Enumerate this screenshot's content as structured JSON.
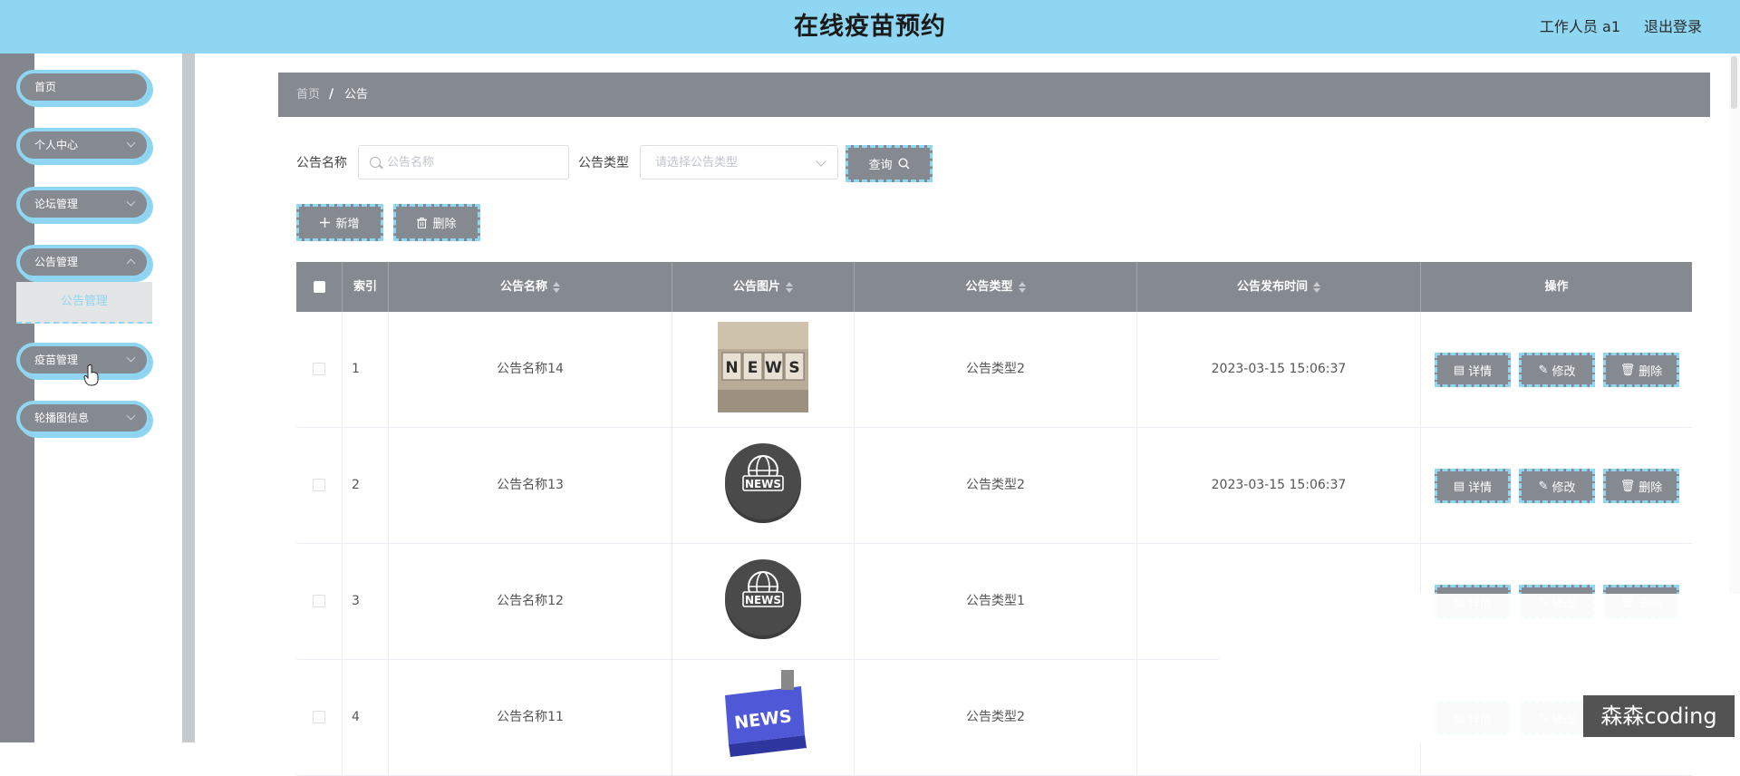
{
  "header": {
    "title": "在线疫苗预约",
    "user": "工作人员 a1",
    "logout": "退出登录"
  },
  "sidebar": {
    "items": [
      {
        "label": "首页",
        "chevron": false
      },
      {
        "label": "个人中心",
        "chevron": true
      },
      {
        "label": "论坛管理",
        "chevron": true
      },
      {
        "label": "公告管理",
        "chevron": true
      },
      {
        "label": "疫苗管理",
        "chevron": true
      },
      {
        "label": "轮播图信息",
        "chevron": true
      }
    ],
    "submenu": {
      "label": "公告管理"
    }
  },
  "breadcrumb": {
    "home": "首页",
    "separator": "/",
    "current": "公告"
  },
  "search": {
    "name_label": "公告名称",
    "name_placeholder": "公告名称",
    "type_label": "公告类型",
    "type_placeholder": "请选择公告类型",
    "query_button": "查询"
  },
  "toolbar": {
    "add_button": "新增",
    "delete_button": "删除"
  },
  "table": {
    "headers": {
      "index": "索引",
      "name": "公告名称",
      "image": "公告图片",
      "type": "公告类型",
      "time": "公告发布时间",
      "actions": "操作"
    },
    "actions": {
      "detail": "详情",
      "edit": "修改",
      "delete": "删除"
    },
    "rows": [
      {
        "index": "1",
        "name": "公告名称14",
        "image": "news-blocks-photo",
        "type": "公告类型2",
        "time": "2023-03-15 15:06:37"
      },
      {
        "index": "2",
        "name": "公告名称13",
        "image": "news-globe-icon",
        "type": "公告类型2",
        "time": "2023-03-15 15:06:37"
      },
      {
        "index": "3",
        "name": "公告名称12",
        "image": "news-globe-icon",
        "type": "公告类型1",
        "time": ""
      },
      {
        "index": "4",
        "name": "公告名称11",
        "image": "news-keyboard-key",
        "type": "公告类型2",
        "time": ""
      }
    ]
  },
  "watermark": "森森coding",
  "colors": {
    "header_bg": "#8fd6f2",
    "accent": "#8fd6f2",
    "gray": "#858a90"
  }
}
